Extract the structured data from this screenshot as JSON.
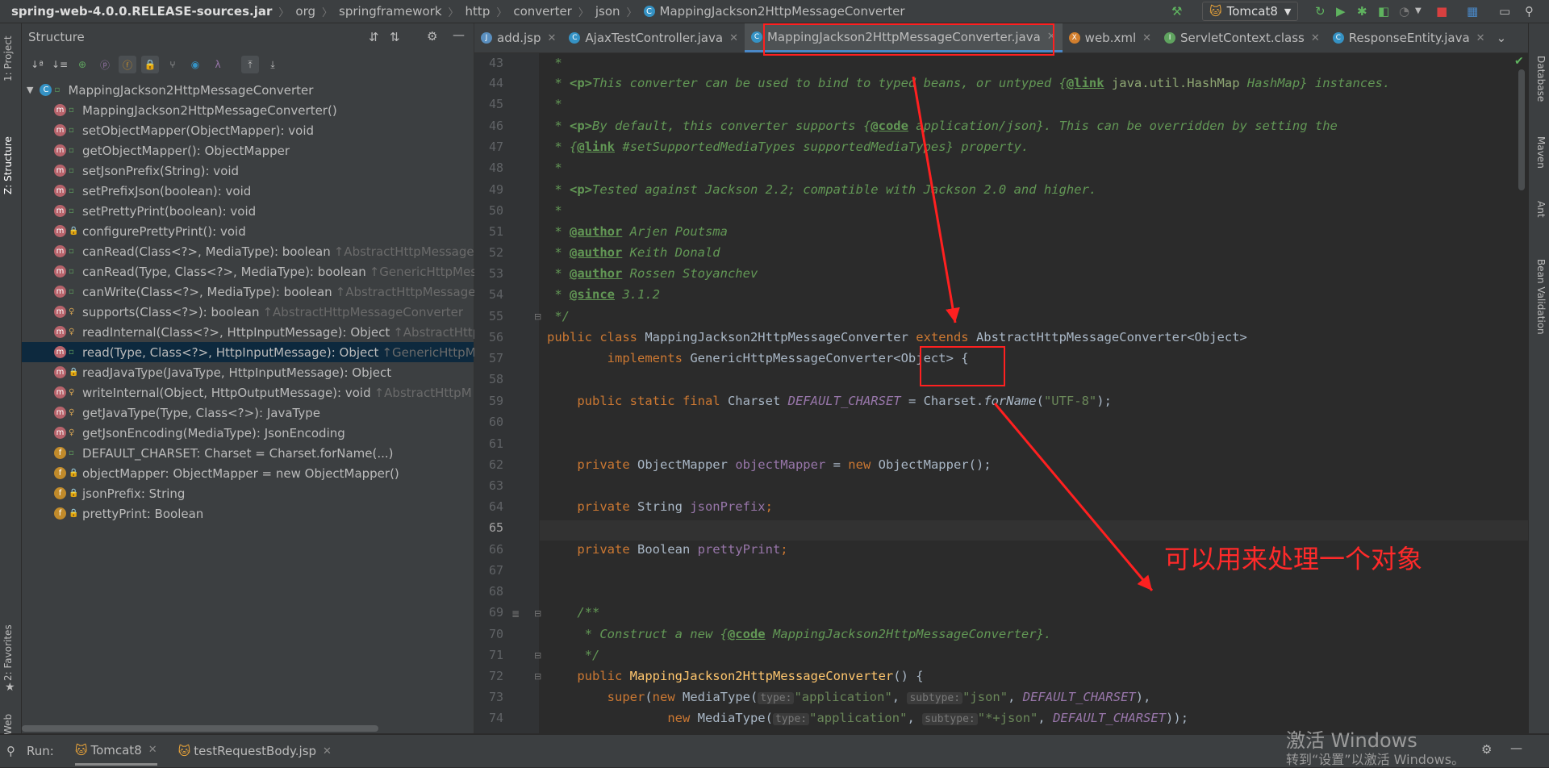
{
  "breadcrumb": [
    "spring-web-4.0.0.RELEASE-sources.jar",
    "org",
    "springframework",
    "http",
    "converter",
    "json",
    "MappingJackson2HttpMessageConverter"
  ],
  "run_config": "Tomcat8",
  "left_strip": {
    "project": "1: Project",
    "structure": "Z: Structure",
    "favorites": "2: Favorites",
    "web": "Web"
  },
  "right_strip": {
    "database": "Database",
    "maven": "Maven",
    "ant": "Ant",
    "bean": "Bean Validation"
  },
  "structure": {
    "title": "Structure",
    "root": "MappingJackson2HttpMessageConverter",
    "items": [
      {
        "label": "MappingJackson2HttpMessageConverter()",
        "hint": "",
        "kind": "m",
        "vis": "pub"
      },
      {
        "label": "setObjectMapper(ObjectMapper): void",
        "hint": "",
        "kind": "m",
        "vis": "pub"
      },
      {
        "label": "getObjectMapper(): ObjectMapper",
        "hint": "",
        "kind": "m",
        "vis": "pub"
      },
      {
        "label": "setJsonPrefix(String): void",
        "hint": "",
        "kind": "m",
        "vis": "pub"
      },
      {
        "label": "setPrefixJson(boolean): void",
        "hint": "",
        "kind": "m",
        "vis": "pub"
      },
      {
        "label": "setPrettyPrint(boolean): void",
        "hint": "",
        "kind": "m",
        "vis": "pub"
      },
      {
        "label": "configurePrettyPrint(): void",
        "hint": "",
        "kind": "m",
        "vis": "priv"
      },
      {
        "label": "canRead(Class<?>, MediaType): boolean",
        "hint": "↑AbstractHttpMessage",
        "kind": "m",
        "vis": "pub"
      },
      {
        "label": "canRead(Type, Class<?>, MediaType): boolean",
        "hint": "↑GenericHttpMes",
        "kind": "m",
        "vis": "pub"
      },
      {
        "label": "canWrite(Class<?>, MediaType): boolean",
        "hint": "↑AbstractHttpMessage",
        "kind": "m",
        "vis": "pub"
      },
      {
        "label": "supports(Class<?>): boolean",
        "hint": "↑AbstractHttpMessageConverter",
        "kind": "m",
        "vis": "prot"
      },
      {
        "label": "readInternal(Class<?>, HttpInputMessage): Object",
        "hint": "↑AbstractHttp",
        "kind": "m",
        "vis": "prot"
      },
      {
        "label": "read(Type, Class<?>, HttpInputMessage): Object",
        "hint": "↑GenericHttpM",
        "kind": "m",
        "vis": "pub"
      },
      {
        "label": "readJavaType(JavaType, HttpInputMessage): Object",
        "hint": "",
        "kind": "m",
        "vis": "priv"
      },
      {
        "label": "writeInternal(Object, HttpOutputMessage): void",
        "hint": "↑AbstractHttpM",
        "kind": "m",
        "vis": "prot"
      },
      {
        "label": "getJavaType(Type, Class<?>): JavaType",
        "hint": "",
        "kind": "m",
        "vis": "prot"
      },
      {
        "label": "getJsonEncoding(MediaType): JsonEncoding",
        "hint": "",
        "kind": "m",
        "vis": "prot"
      },
      {
        "label": "DEFAULT_CHARSET: Charset = Charset.forName(...)",
        "hint": "",
        "kind": "f",
        "vis": "pub"
      },
      {
        "label": "objectMapper: ObjectMapper = new ObjectMapper()",
        "hint": "",
        "kind": "f",
        "vis": "priv"
      },
      {
        "label": "jsonPrefix: String",
        "hint": "",
        "kind": "f",
        "vis": "priv"
      },
      {
        "label": "prettyPrint: Boolean",
        "hint": "",
        "kind": "f",
        "vis": "priv"
      }
    ]
  },
  "tabs": [
    "add.jsp",
    "AjaxTestController.java",
    "MappingJackson2HttpMessageConverter.java",
    "web.xml",
    "ServletContext.class",
    "ResponseEntity.java"
  ],
  "line_numbers": [
    "43",
    "44",
    "45",
    "46",
    "47",
    "48",
    "49",
    "50",
    "51",
    "52",
    "53",
    "54",
    "55",
    "56",
    "57",
    "58",
    "59",
    "60",
    "61",
    "62",
    "63",
    "64",
    "65",
    "66",
    "67",
    "68",
    "69",
    "70",
    "71",
    "72",
    "73",
    "74"
  ],
  "code": {
    "l43": " *",
    "l44_a": " * ",
    "l44_b": "<p>",
    "l44_c": "This converter can be used to bind to typed beans, or untyped {",
    "l44_d": "@link",
    "l44_e": " java.util.HashMap",
    "l44_f": " HashMap} instances.",
    "l45": " *",
    "l46_a": " * ",
    "l46_b": "<p>",
    "l46_c": "By default, this converter supports {",
    "l46_d": "@code",
    "l46_e": " application/json}. This can be overridden by setting the",
    "l47_a": " * {",
    "l47_b": "@link",
    "l47_c": " #setSupportedMediaTypes supportedMediaTypes} property.",
    "l48": " *",
    "l49_a": " * ",
    "l49_b": "<p>",
    "l49_c": "Tested against Jackson 2.2; compatible with Jackson 2.0 and higher.",
    "l50": " *",
    "l51_a": " * ",
    "l51_b": "@author",
    "l51_c": " Arjen Poutsma",
    "l52_a": " * ",
    "l52_b": "@author",
    "l52_c": " Keith Donald",
    "l53_a": " * ",
    "l53_b": "@author",
    "l53_c": " Rossen Stoyanchev",
    "l54_a": " * ",
    "l54_b": "@since",
    "l54_c": " 3.1.2",
    "l55": " */",
    "l56_a": "public class ",
    "l56_b": "MappingJackson2HttpMessageConverter ",
    "l56_c": "extends ",
    "l56_d": "AbstractHttpMessageConverter<Object>",
    "l57_a": "        implements ",
    "l57_b": "GenericHttpMessageConverter<Object> {",
    "l59_a": "    public static final ",
    "l59_b": "Charset ",
    "l59_c": "DEFAULT_CHARSET",
    "l59_d": " = Charset.",
    "l59_e": "forName",
    "l59_f": "(",
    "l59_g": "\"UTF-8\"",
    "l59_h": ");",
    "l62_a": "    private ",
    "l62_b": "ObjectMapper ",
    "l62_c": "objectMapper",
    "l62_d": " = ",
    "l62_e": "new ",
    "l62_f": "ObjectMapper();",
    "l64_a": "    private ",
    "l64_b": "String ",
    "l64_c": "jsonPrefix",
    "l64_d": ";",
    "l66_a": "    private ",
    "l66_b": "Boolean ",
    "l66_c": "prettyPrint",
    "l66_d": ";",
    "l69": "    /**",
    "l70_a": "     * Construct a new {",
    "l70_b": "@code",
    "l70_c": " MappingJackson2HttpMessageConverter}.",
    "l71": "     */",
    "l72_a": "    public ",
    "l72_b": "MappingJackson2HttpMessageConverter",
    "l72_c": "() {",
    "l73_a": "        ",
    "l73_b": "super",
    "l73_c": "(",
    "l73_d": "new ",
    "l73_e": "MediaType(",
    "l73_h1": "type:",
    "l73_f": "\"application\"",
    "l73_g": ", ",
    "l73_h2": "subtype:",
    "l73_i": "\"json\"",
    "l73_j": ", ",
    "l73_k": "DEFAULT_CHARSET",
    "l73_l": "),",
    "l74_a": "                ",
    "l74_b": "new ",
    "l74_c": "MediaType(",
    "l74_h1": "type:",
    "l74_d": "\"application\"",
    "l74_e": ", ",
    "l74_h2": "subtype:",
    "l74_f": "\"*+json\"",
    "l74_g": ", ",
    "l74_h": "DEFAULT_CHARSET",
    "l74_i": "));"
  },
  "annotation": "可以用来处理一个对象",
  "runbar": {
    "label": "Run:",
    "tab1": "Tomcat8",
    "tab2": "testRequestBody.jsp"
  },
  "watermark": {
    "line1": "激活 Windows",
    "line2": "转到“设置”以激活 Windows。"
  },
  "colors": {
    "annotation_red": "#ff2020",
    "accent_blue": "#4a88c7",
    "keyword": "#cc7832",
    "doc_green": "#629755"
  }
}
